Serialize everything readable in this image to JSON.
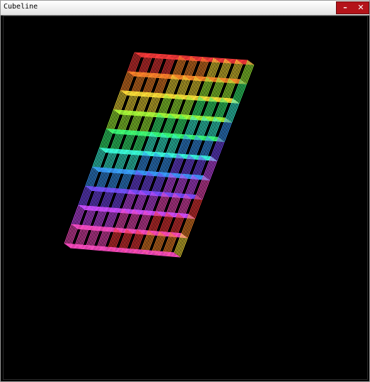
{
  "window": {
    "title": "Cubeline",
    "minimize_label": "–",
    "close_label": "✕",
    "close_group_color": "#b4141a"
  },
  "scene": {
    "background": "#000000",
    "palette": [
      "#ff3c3c",
      "#ff8a2a",
      "#ffe43a",
      "#a8ff3a",
      "#3aff7a",
      "#3affe0",
      "#3a9dff",
      "#7a4dff",
      "#d24dff",
      "#ff4dc4"
    ]
  }
}
